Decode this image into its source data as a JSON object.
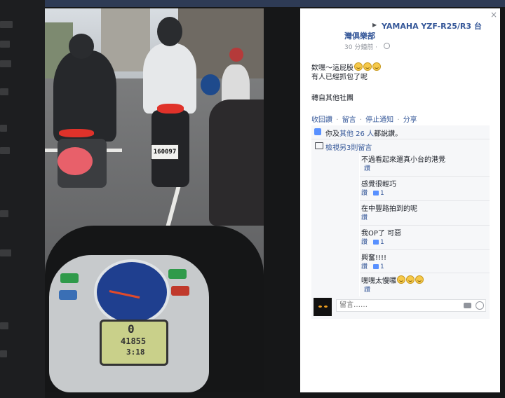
{
  "post": {
    "group_name": "YAMAHA YZF-R25/R3 台灣俱樂部",
    "time": "30 分鐘前 ·",
    "text_line1": "欸嘿～這屁股",
    "text_line2": "有人已經抓包了呢",
    "text_line3": "轉自其他社團",
    "emoji_icon": "grin-emoji"
  },
  "photo": {
    "plate": "160097",
    "lcd_odometer": "41855",
    "lcd_time": "3:18",
    "lcd_gear": "0"
  },
  "actions": {
    "like": "收回讚",
    "comment": "留言",
    "stop": "停止通知",
    "share": "分享",
    "sep": "·"
  },
  "likes": {
    "prefix": "你及",
    "others": "其他 26 人",
    "suffix": "都說讚。"
  },
  "view_more": "檢視另3則留言",
  "comments": [
    {
      "text": "不過看起來還真小台的港覺",
      "like_label": "讚",
      "count": ""
    },
    {
      "text": "感覺很輕巧",
      "like_label": "讚",
      "count": "1"
    },
    {
      "text": "在中豐路拍到的呢",
      "like_label": "讚",
      "count": ""
    },
    {
      "text": "我OP了 可惡",
      "like_label": "讚",
      "count": "1"
    },
    {
      "text": "興奮!!!!",
      "like_label": "讚",
      "count": "1"
    },
    {
      "text": "嘿嘿太慢囉",
      "like_label": "讚",
      "count": ""
    }
  ],
  "reply": {
    "placeholder": "留言……"
  },
  "close": "×"
}
